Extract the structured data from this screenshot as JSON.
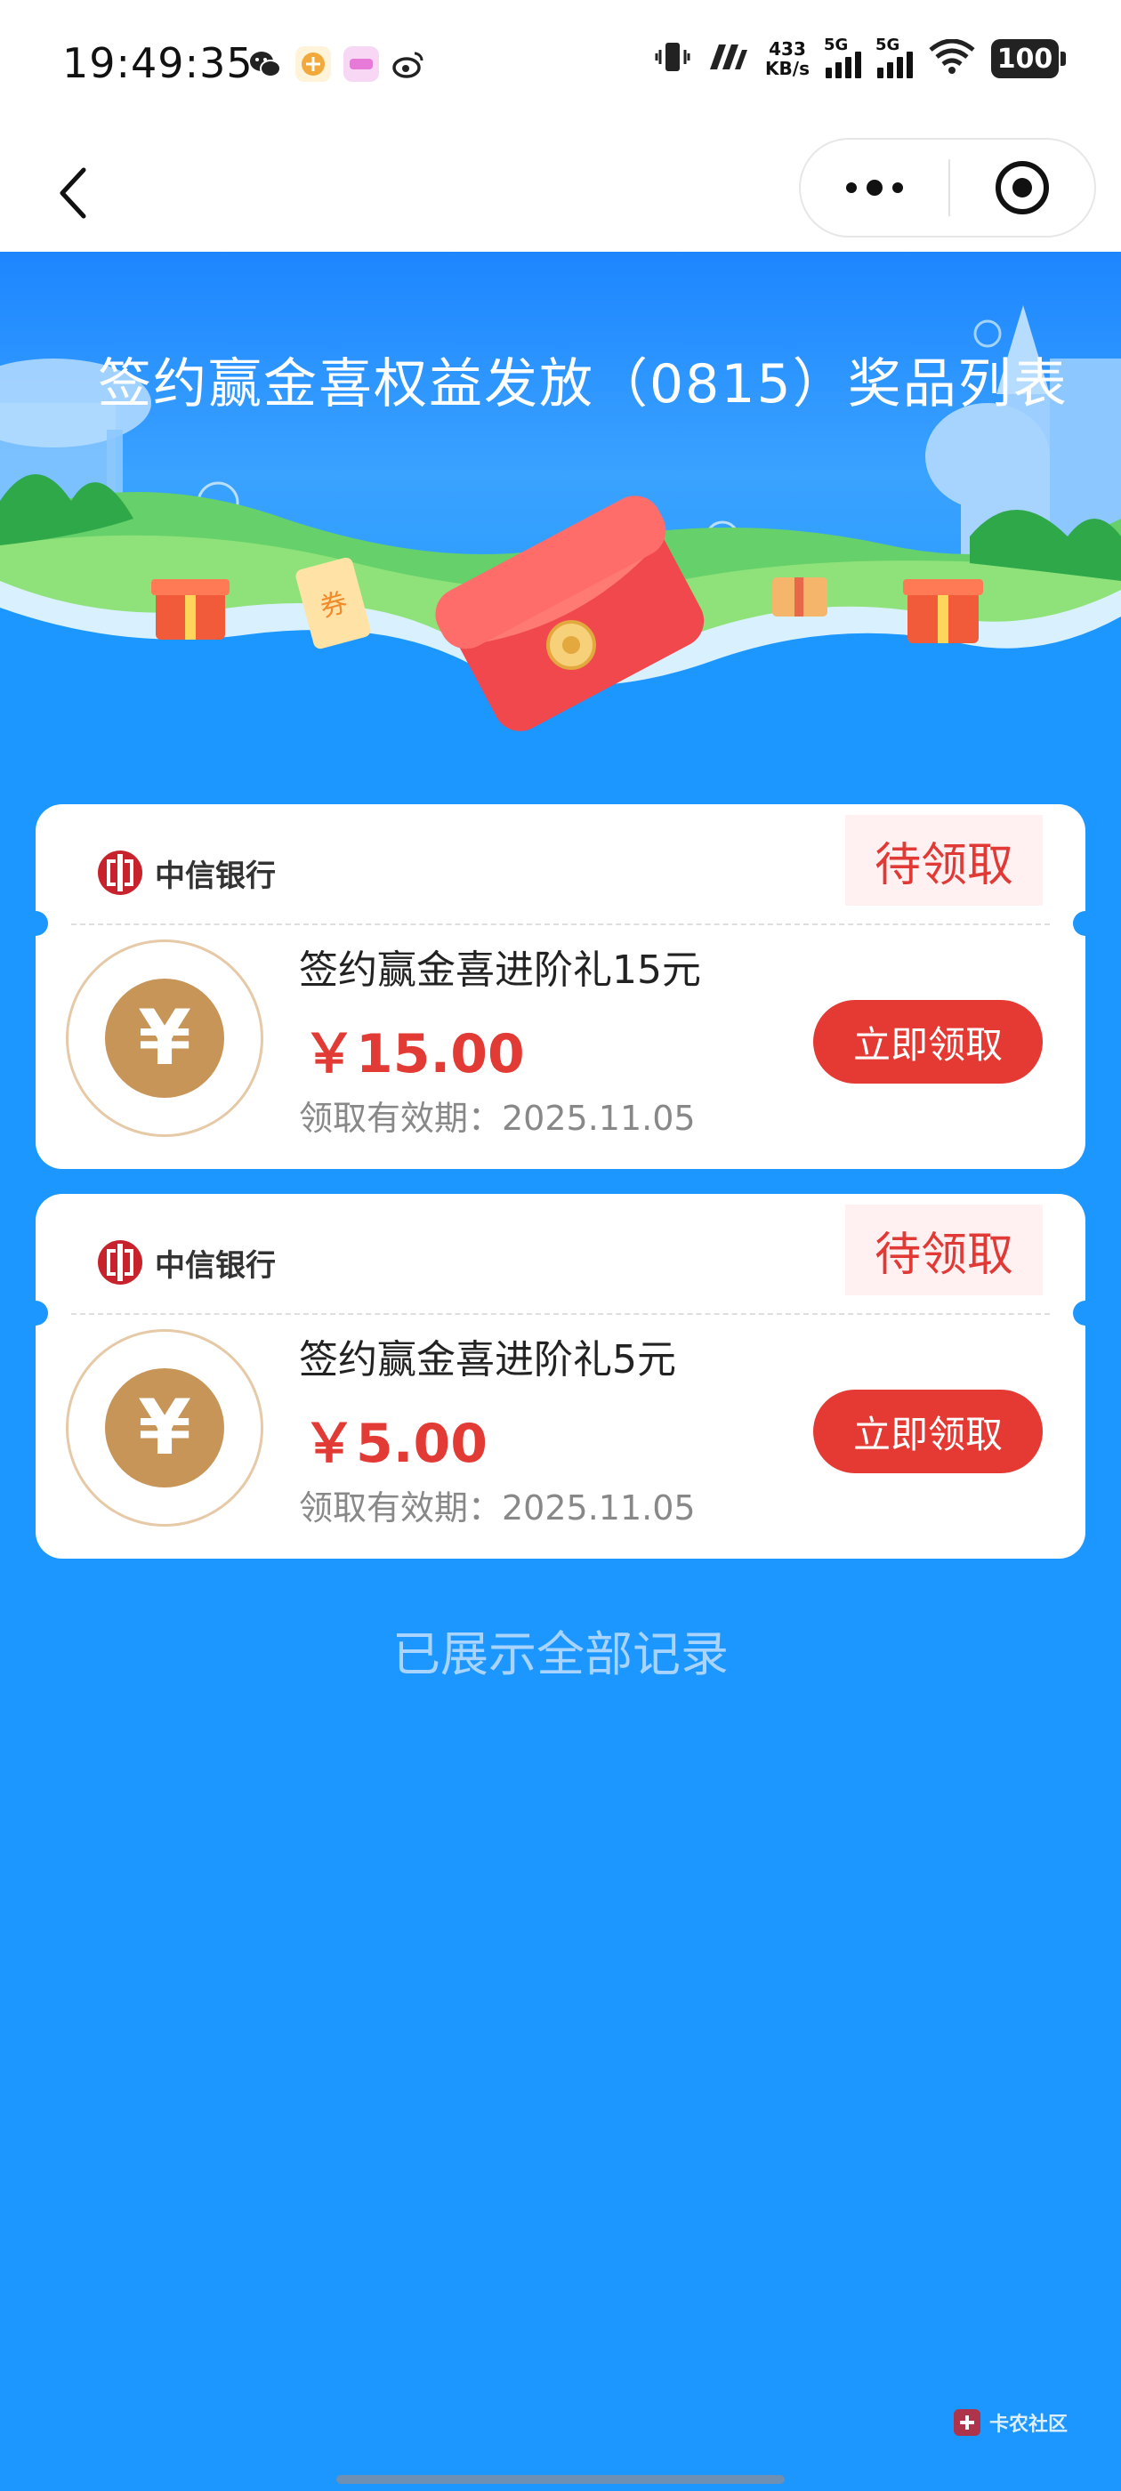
{
  "status_bar": {
    "time": "19:49:35",
    "net_speed_value": "433",
    "net_speed_unit": "KB/s",
    "sim1_label": "5G",
    "sim2_label": "5G",
    "battery": "100"
  },
  "page": {
    "title": "签约赢金喜权益发放（0815）奖品列表"
  },
  "prizes": [
    {
      "bank_name": "中信银行",
      "status": "待领取",
      "name": "签约赢金喜进阶礼15元",
      "amount": "￥15.00",
      "valid": "领取有效期：2025.11.05",
      "button": "立即领取",
      "coin_symbol": "¥"
    },
    {
      "bank_name": "中信银行",
      "status": "待领取",
      "name": "签约赢金喜进阶礼5元",
      "amount": "￥5.00",
      "valid": "领取有效期：2025.11.05",
      "button": "立即领取",
      "coin_symbol": "¥"
    }
  ],
  "footer": {
    "end_text": "已展示全部记录",
    "watermark": "卡农社区"
  },
  "colors": {
    "background": "#1b97ff",
    "accent_red": "#e53a33",
    "coin_gold": "#c89559"
  }
}
